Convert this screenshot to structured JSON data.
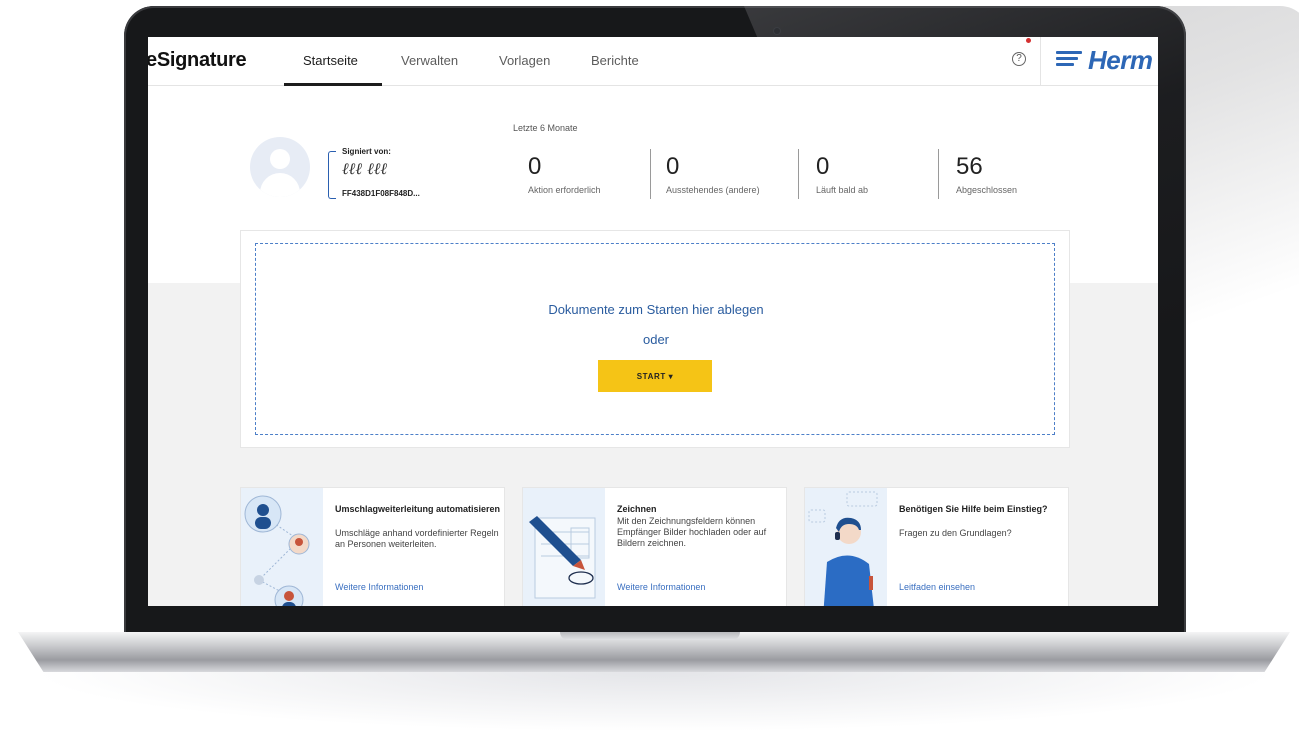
{
  "app": {
    "name": "eSignature",
    "logo_text": "Herm"
  },
  "nav": {
    "tabs": [
      {
        "label": "Startseite",
        "active": true
      },
      {
        "label": "Verwalten",
        "active": false
      },
      {
        "label": "Vorlagen",
        "active": false
      },
      {
        "label": "Berichte",
        "active": false
      }
    ],
    "help_icon": "?"
  },
  "profile": {
    "signed_by_label": "Signiert von:",
    "signature_scribble": "ℓℓℓ ℓℓℓ",
    "signature_id": "FF438D1F08F848D..."
  },
  "stats": {
    "period": "Letzte 6 Monate",
    "items": [
      {
        "value": "0",
        "label": "Aktion erforderlich"
      },
      {
        "value": "0",
        "label": "Ausstehendes (andere)"
      },
      {
        "value": "0",
        "label": "Läuft bald ab"
      },
      {
        "value": "56",
        "label": "Abgeschlossen"
      }
    ]
  },
  "dropzone": {
    "text": "Dokumente zum Starten hier ablegen",
    "or": "oder",
    "start_label": "START ▾"
  },
  "cards": [
    {
      "title": "Umschlagweiterleitung automatisieren",
      "description": "Umschläge anhand vordefinierter Regeln an Personen weiterleiten.",
      "link": "Weitere Informationen"
    },
    {
      "title": "Zeichnen",
      "description": "Mit den Zeichnungsfeldern können Empfänger Bilder hochladen oder auf Bildern zeichnen.",
      "link": "Weitere Informationen"
    },
    {
      "title": "Benötigen Sie Hilfe beim Einstieg?",
      "description": "Fragen zu den Grundlagen?",
      "link": "Leitfaden einsehen"
    }
  ],
  "colors": {
    "accent_yellow": "#f5c416",
    "link_blue": "#3a6fc0",
    "brand_blue": "#2d67b6"
  }
}
